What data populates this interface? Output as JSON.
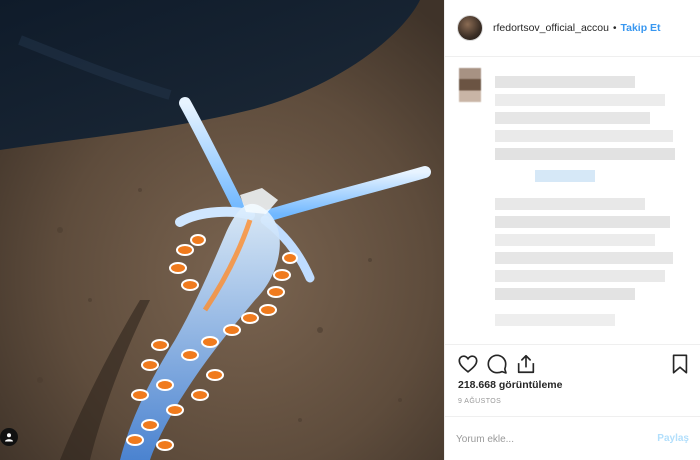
{
  "header": {
    "username": "rfedortsov_official_accou",
    "separator": "•",
    "follow_label": "Takip Et"
  },
  "actions": {
    "icons": [
      "heart-icon",
      "comment-icon",
      "share-icon",
      "bookmark-icon"
    ]
  },
  "stats": {
    "views": "218.668 görüntüleme",
    "date": "9 AĞUSTOS"
  },
  "comment": {
    "placeholder": "Yorum ekle...",
    "post_label": "Paylaş"
  },
  "colors": {
    "accent": "#3897f0",
    "post_disabled": "#b2dffc",
    "border": "#efefef"
  }
}
